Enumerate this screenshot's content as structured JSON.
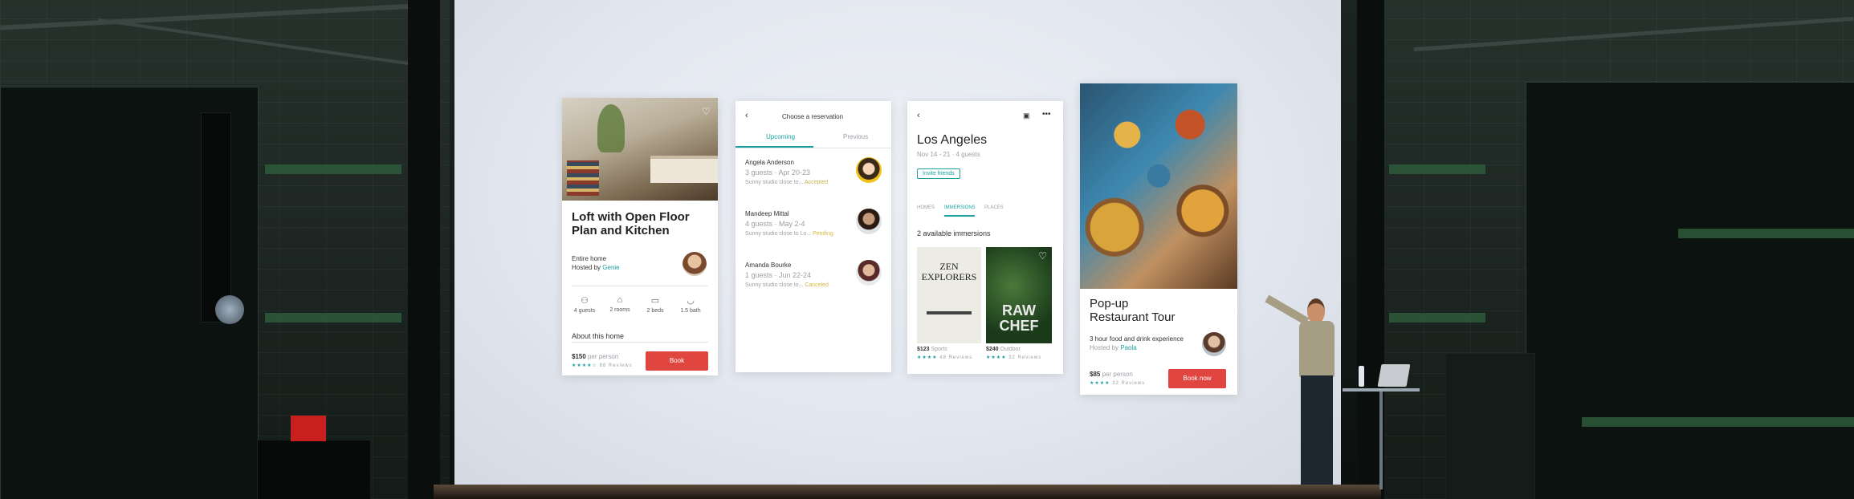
{
  "card1": {
    "title_line1": "Loft with Open Floor",
    "title_line2": "Plan and Kitchen",
    "type": "Entire home",
    "hosted_by_prefix": "Hosted by",
    "host_name": "Genie",
    "amenities": [
      {
        "icon": "guests-icon",
        "label": "4 guests"
      },
      {
        "icon": "rooms-icon",
        "label": "2 rooms"
      },
      {
        "icon": "beds-icon",
        "label": "2 beds"
      },
      {
        "icon": "bath-icon",
        "label": "1.5 bath"
      }
    ],
    "section_title": "About this home",
    "price": "$150",
    "price_suffix": "per person",
    "reviews": "88 Reviews",
    "button": "Book"
  },
  "card2": {
    "header": "Choose a reservation",
    "tabs": [
      "Upcoming",
      "Previous"
    ],
    "reservations": [
      {
        "name": "Angela Anderson",
        "details": "3 guests · Apr 20-23",
        "note": "Sunny studio close to...",
        "status": "Accepted"
      },
      {
        "name": "Mandeep Mittal",
        "details": "4 guests · May 2-4",
        "note": "Sunny studio close to Lo...",
        "status": "Pending"
      },
      {
        "name": "Amanda Bourke",
        "details": "1 guests · Jun 22-24",
        "note": "Sunny studio close to...",
        "status": "Canceled"
      }
    ]
  },
  "card3": {
    "city": "Los Angeles",
    "dates": "Nov 14 - 21 · 4 guests",
    "invite": "Invite friends",
    "tabs": [
      "HOMES",
      "IMMERSIONS",
      "PLACES"
    ],
    "count_label": "2 available immersions",
    "items": [
      {
        "cover_line1": "ZEN",
        "cover_line2": "EXPLORERS",
        "price": "$123",
        "category": "Sports",
        "reviews": "48 Reviews"
      },
      {
        "cover_line1": "RAW",
        "cover_line2": "CHEF",
        "price": "$240",
        "category": "Outdoor",
        "reviews": "32 Reviews"
      }
    ]
  },
  "card4": {
    "title_line1": "Pop-up",
    "title_line2": "Restaurant Tour",
    "subtitle": "3 hour food and drink experience",
    "hosted_by_prefix": "Hosted by",
    "host_name": "Paola",
    "price": "$85",
    "price_suffix": "per person",
    "reviews": "32 Reviews",
    "button": "Book now"
  },
  "colors": {
    "accent_red": "#e0453f",
    "accent_teal": "#1aa0a0",
    "screen": "#e6e9f0",
    "wall": "#1c2522"
  }
}
